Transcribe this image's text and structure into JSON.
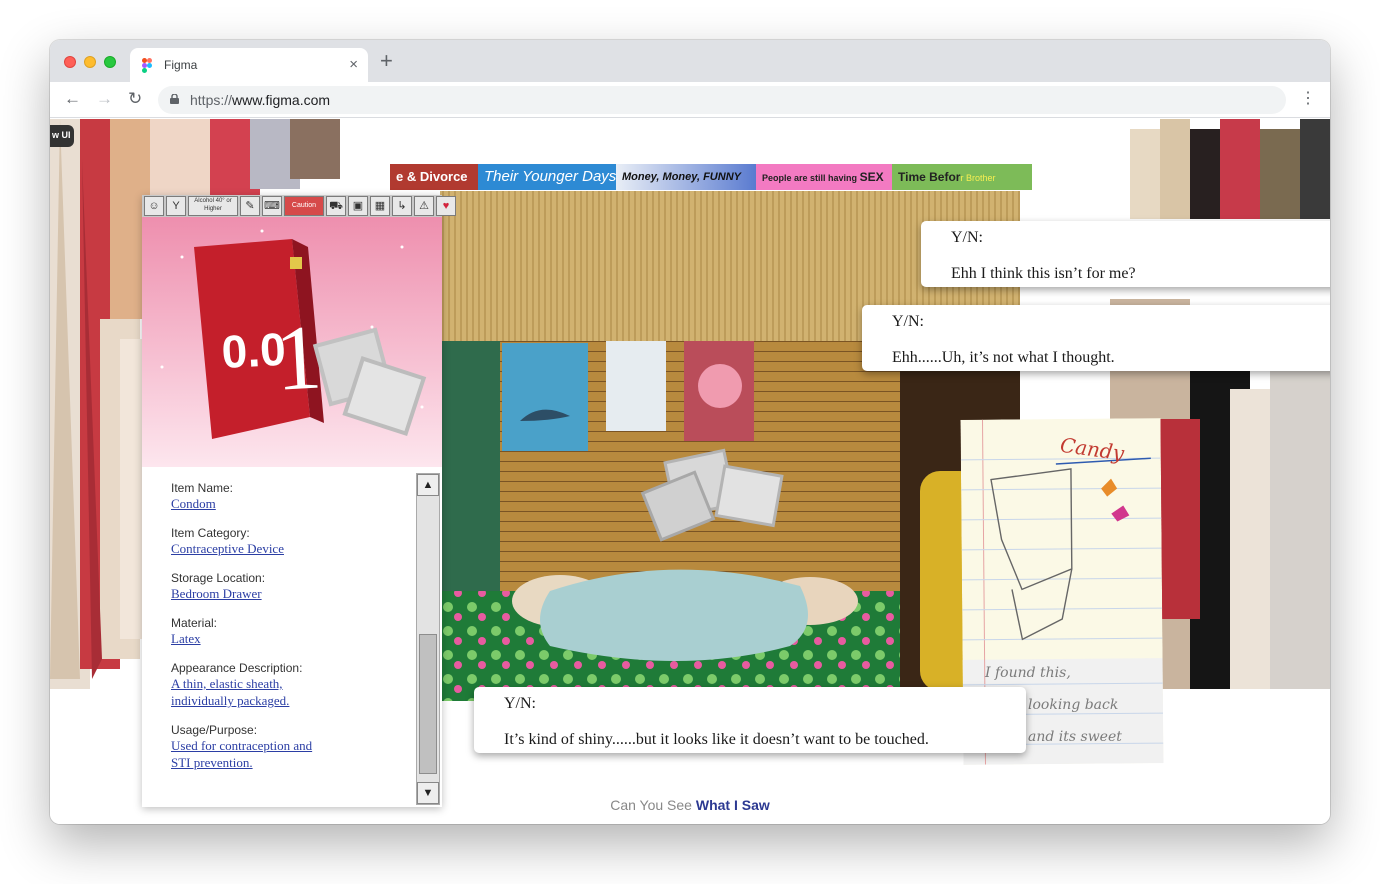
{
  "browser": {
    "tab_title": "Figma",
    "tab_close": "×",
    "new_tab": "+",
    "url_proto": "https://",
    "url_host": "www.figma.com",
    "back": "←",
    "forward": "→",
    "reload": "↻",
    "menu": "⋮"
  },
  "badge": "w UI",
  "channels": [
    {
      "label": "e & Divorce"
    },
    {
      "label": "Their Younger Days"
    },
    {
      "label": "Money, Money, FUNNY"
    },
    {
      "label": "People are still having",
      "label_big": "SEX"
    },
    {
      "label": "Time Befor",
      "label_small": "r Brother"
    }
  ],
  "toolbar_icons": [
    "☺",
    "Y",
    "Alcohol 40° or Higher",
    "✎",
    "⌨",
    "Caution",
    "⛟",
    "▣",
    "▦",
    "↳",
    "⚠",
    "♥"
  ],
  "item": {
    "fields": [
      {
        "label": "Item Name:",
        "value": "Condom"
      },
      {
        "label": "Item Category:",
        "value": "Contraceptive Device"
      },
      {
        "label": "Storage Location:",
        "value": "Bedroom Drawer"
      },
      {
        "label": "Material:",
        "value": "Latex"
      },
      {
        "label": "Appearance Description:",
        "value": "A thin, elastic sheath, individually packaged."
      },
      {
        "label": "Usage/Purpose:",
        "value": "Used for contraception and STI prevention."
      }
    ],
    "scroll_up": "▲",
    "scroll_down": "▼"
  },
  "dialogs": [
    {
      "speaker": "Y/N:",
      "line": "Ehh I think this isn’t for me?"
    },
    {
      "speaker": "Y/N:",
      "line": "Ehh......Uh, it’s not what I thought."
    },
    {
      "speaker": "Y/N:",
      "line": "It’s kind of shiny......but it looks like it doesn’t want to be touched."
    }
  ],
  "note": {
    "title": "Candy",
    "line1": "I found this,",
    "line2": "looking back",
    "line3": "and its sweet"
  },
  "footer": {
    "prefix": "Can You See ",
    "accent": "What I Saw"
  },
  "colors": {
    "link": "#2b3ea4",
    "accent": "#2c3992",
    "product_box": "#d9232f"
  }
}
